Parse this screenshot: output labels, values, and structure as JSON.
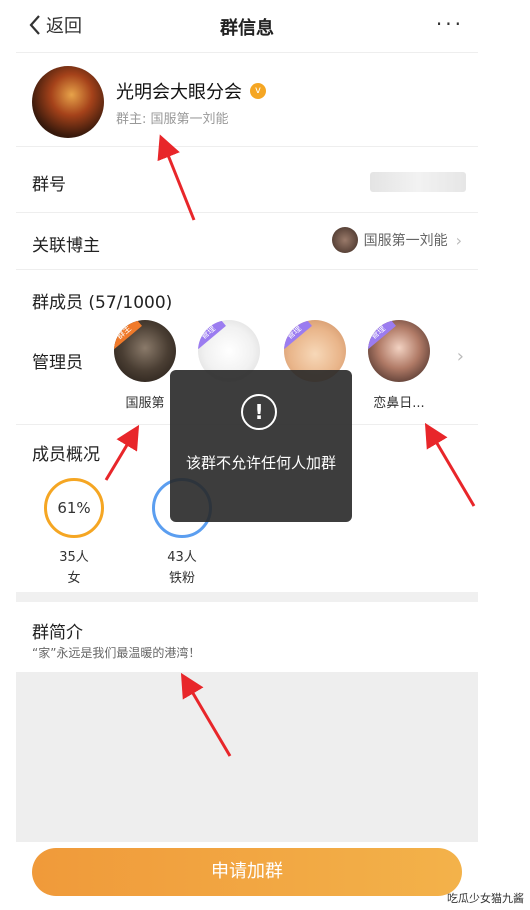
{
  "nav": {
    "back_label": "返回",
    "title": "群信息",
    "more_label": "···"
  },
  "group": {
    "name": "光明会大眼分会",
    "vip_badge": "v",
    "owner_line": "群主: 国服第一刘能"
  },
  "rows": {
    "group_number_label": "群号",
    "blogger_label": "关联博主",
    "blogger_name": "国服第一刘能",
    "members_label": "群成员 (57/1000)",
    "admins_label": "管理员"
  },
  "admins": [
    {
      "name": "国服第",
      "badge": "群主",
      "badge_color": "#f07a2a"
    },
    {
      "name": "",
      "badge": "管理",
      "badge_color": "#9b7cf0"
    },
    {
      "name": "",
      "badge": "管理",
      "badge_color": "#9b7cf0"
    },
    {
      "name": "恋鼻日...",
      "badge": "管理",
      "badge_color": "#9b7cf0"
    }
  ],
  "overview": {
    "label": "成员概况",
    "stats": [
      {
        "percent": "61%",
        "count": "35人",
        "label": "女",
        "ring_color": "#f5a623"
      },
      {
        "percent": "",
        "count": "43人",
        "label": "铁粉",
        "ring_color": "#5b9ef0"
      }
    ]
  },
  "intro": {
    "label": "群简介",
    "text": "“家”永远是我们最温暖的港湾！"
  },
  "apply_button": "申请加群",
  "toast": {
    "icon": "!",
    "message": "该群不允许任何人加群"
  },
  "watermark": "吃瓜少女猫九酱",
  "colors": {
    "accent_orange": "#f09a3a",
    "ribbon_purple": "#9b7cf0",
    "arrow_red": "#e8262a"
  }
}
